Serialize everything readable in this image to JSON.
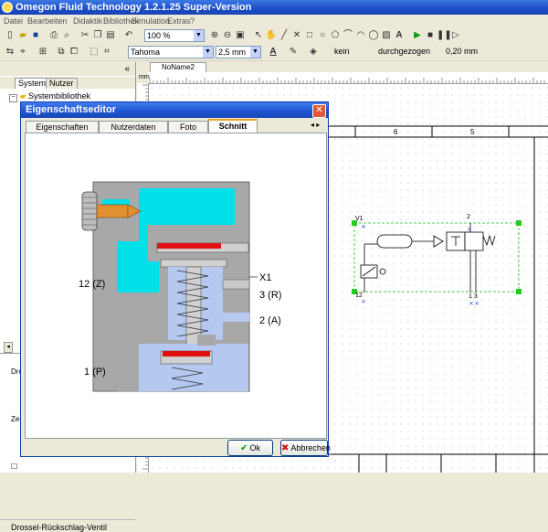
{
  "app": {
    "title": "Omegon Fluid Technology  1.2.1.25  Super-Version"
  },
  "menu": [
    "Datei",
    "Bearbeiten",
    "Didaktik",
    "Bibliothek",
    "Simulation",
    "Extras",
    "?"
  ],
  "toolbar": {
    "zoom": "100 %",
    "font": "Tahoma",
    "font_size": "2,5 mm",
    "fill_label": "kein",
    "line_style": "durchgezogen",
    "line_width": "0,20 mm"
  },
  "leftpane": {
    "tabs": [
      "System",
      "Nutzer"
    ],
    "tree_root": "Systembibliothek",
    "section_label": "Dros",
    "section_label2": "Zei",
    "bottom_label": "Drossel-Rückschlag-Ventil"
  },
  "document": {
    "tab": "NoName2",
    "ruler_unit": "mm",
    "column_numbers": [
      "6",
      "5"
    ],
    "component_labels": {
      "v1": "V1",
      "port_top": "2",
      "port_left": "12",
      "port_bottom": "1 3"
    }
  },
  "dialog": {
    "title": "Eigenschaftseditor",
    "tabs": [
      "Eigenschaften",
      "Nutzerdaten",
      "Foto",
      "Schnitt"
    ],
    "active_tab": "Schnitt",
    "cut_labels": {
      "left_top": "12 (Z)",
      "left_bottom": "1 (P)",
      "right_x1": "X1",
      "right_3": "3 (R)",
      "right_2": "2 (A)"
    },
    "ok": "Ok",
    "cancel": "Abbrechen"
  },
  "colors": {
    "titlebar": "#1a4fc4",
    "cyan": "#00e0e8",
    "body_gray": "#a8a8a8",
    "spring_blue": "#b4c8f0",
    "red": "#e01010",
    "selection_green": "#22bb22"
  }
}
